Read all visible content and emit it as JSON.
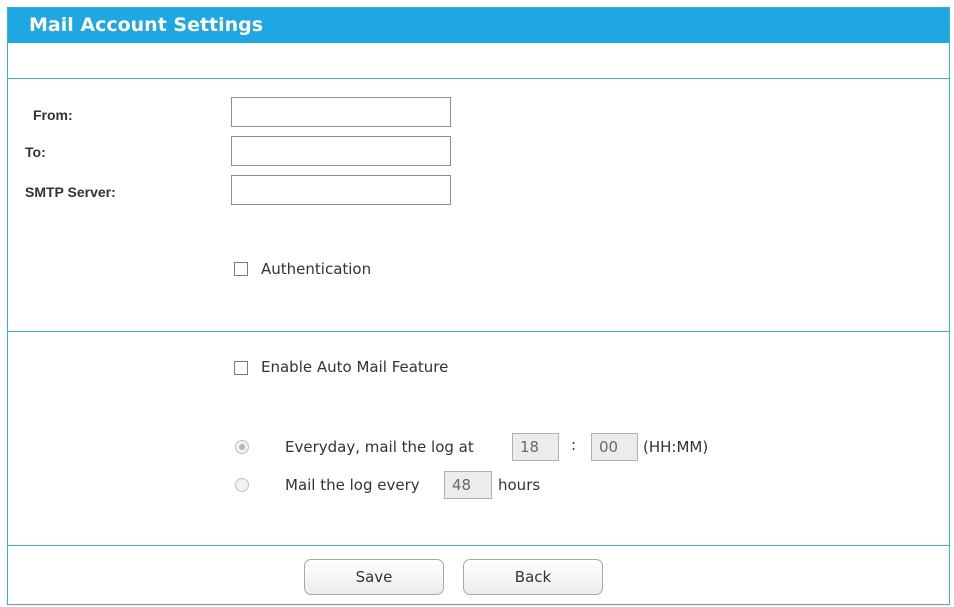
{
  "page": {
    "title": "Mail Account Settings"
  },
  "fields": {
    "from": {
      "label": "From:",
      "value": ""
    },
    "to": {
      "label": "To:",
      "value": ""
    },
    "smtp_server": {
      "label": "SMTP Server:",
      "value": ""
    }
  },
  "authentication": {
    "label": "Authentication",
    "checked": false
  },
  "auto_mail": {
    "label": "Enable Auto Mail Feature",
    "checked": false
  },
  "schedule": {
    "everyday": {
      "label": "Everyday, mail the log at",
      "hour": "18",
      "separator": ":",
      "minute": "00",
      "format": "(HH:MM)",
      "selected": true
    },
    "interval": {
      "label": "Mail the log every",
      "hours": "48",
      "unit": "hours",
      "selected": false
    }
  },
  "buttons": {
    "save": "Save",
    "back": "Back"
  },
  "colors": {
    "accent": "#1ea7e1",
    "divider": "#3aaedc"
  }
}
